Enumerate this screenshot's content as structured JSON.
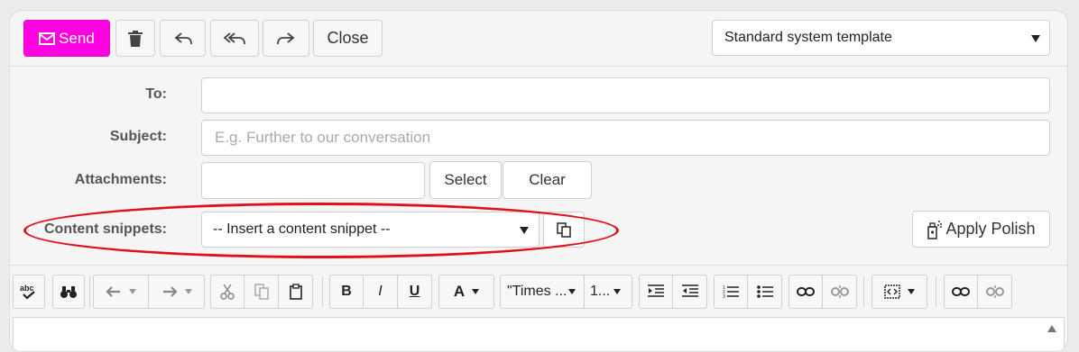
{
  "toolbar": {
    "send_label": "Send",
    "close_label": "Close",
    "template_value": "Standard system template"
  },
  "form": {
    "to_label": "To:",
    "to_value": "",
    "subject_label": "Subject:",
    "subject_placeholder": "E.g. Further to our conversation",
    "attachments_label": "Attachments:",
    "select_label": "Select",
    "clear_label": "Clear",
    "snippets_label": "Content snippets:",
    "snippets_value": "-- Insert a content snippet --",
    "apply_polish_label": "Apply Polish"
  },
  "editor_toolbar": {
    "font_family": "\"Times ...",
    "font_size": "1...",
    "bold": "B",
    "italic": "I",
    "underline": "U",
    "font_color": "A"
  },
  "colors": {
    "accent": "#ff00e1",
    "highlight_oval": "#e0101a"
  }
}
